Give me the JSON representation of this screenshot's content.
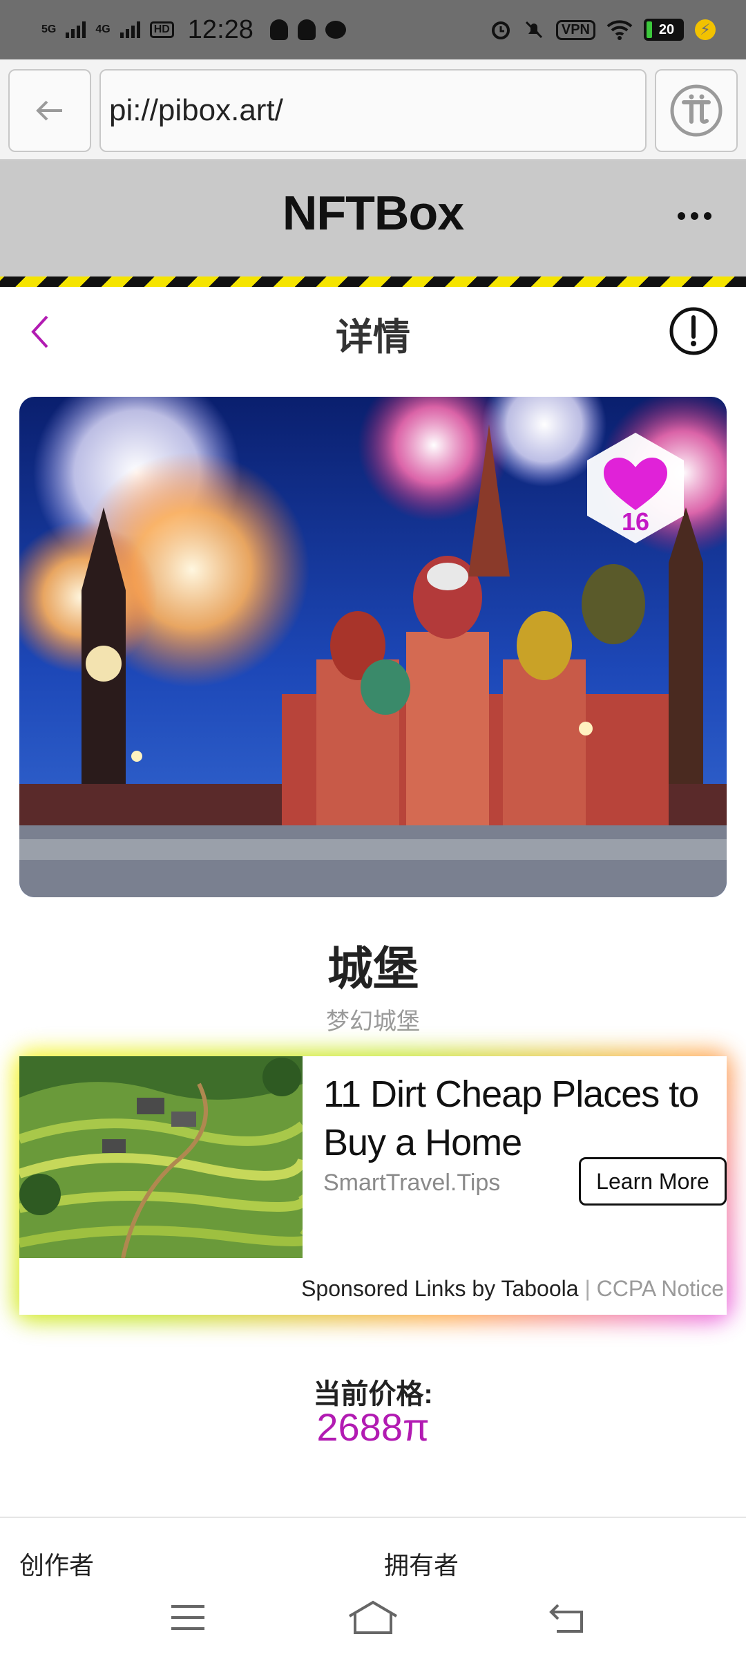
{
  "status_bar": {
    "net1": "5G",
    "net2": "4G",
    "hd": "HD",
    "time": "12:28",
    "vpn": "VPN",
    "battery": "20",
    "charging_symbol": "⚡",
    "icons": [
      "alarm-icon",
      "mute-icon",
      "wifi-icon",
      "battery-icon"
    ]
  },
  "browser": {
    "url": "pi://pibox.art/",
    "back_icon": "arrow-left-icon",
    "pi_icon": "pi-logo-icon"
  },
  "app": {
    "title": "NFTBox",
    "more_icon": "more-horizontal-icon"
  },
  "detail": {
    "title": "详情",
    "back_icon": "chevron-left-icon",
    "info_icon": "exclamation-circle-icon"
  },
  "nft": {
    "likes": "16",
    "name": "城堡",
    "description": "梦幻城堡",
    "price_label": "当前价格:",
    "price_value": "2688π"
  },
  "ad": {
    "headline": "11 Dirt Cheap Places to Buy a Home",
    "source": "SmartTravel.Tips",
    "cta": "Learn More",
    "footer_sponsor": "Sponsored Links by Taboola",
    "footer_separator": "|",
    "footer_ccpa": "CCPA Notice"
  },
  "people": {
    "creator_label": "创作者",
    "owner_label": "拥有者"
  },
  "colors": {
    "accent": "#b21bb2",
    "heart": "#e022d8",
    "header_bg": "#c9c9c9",
    "hazard_yellow": "#f5e400"
  }
}
